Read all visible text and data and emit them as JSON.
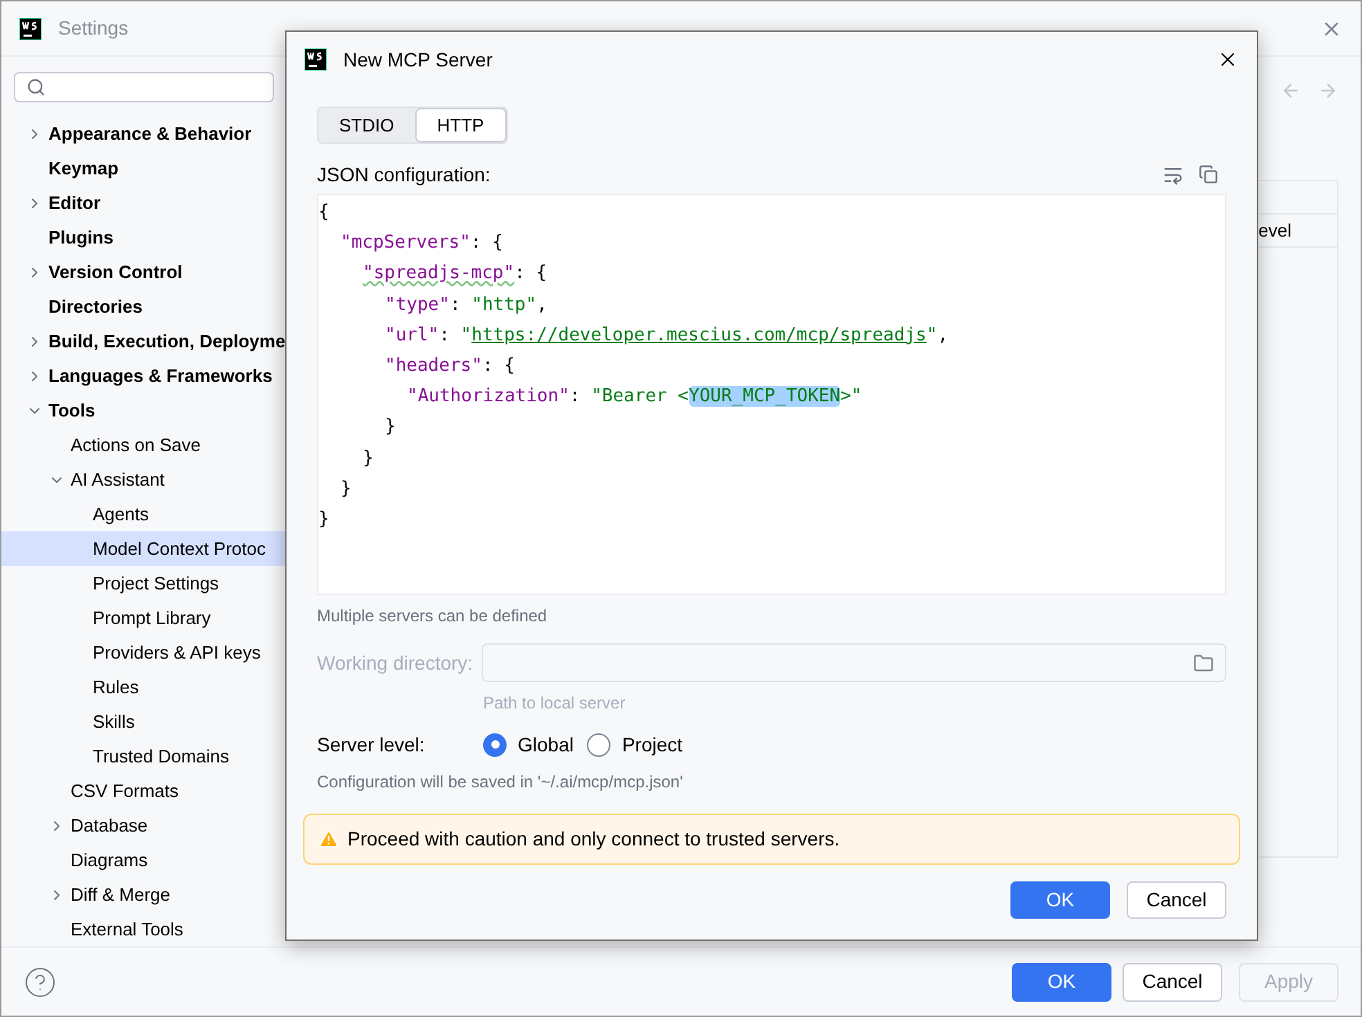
{
  "window": {
    "title": "Settings"
  },
  "sidebar": {
    "items": [
      {
        "label": "Appearance & Behavior",
        "expanded": false
      },
      {
        "label": "Keymap"
      },
      {
        "label": "Editor",
        "expanded": false
      },
      {
        "label": "Plugins"
      },
      {
        "label": "Version Control",
        "expanded": false
      },
      {
        "label": "Directories"
      },
      {
        "label": "Build, Execution, Deployme",
        "expanded": false
      },
      {
        "label": "Languages & Frameworks",
        "expanded": false
      },
      {
        "label": "Tools",
        "expanded": true,
        "children": [
          {
            "label": "Actions on Save"
          },
          {
            "label": "AI Assistant",
            "expanded": true,
            "children": [
              {
                "label": "Agents",
                "selected": false
              },
              {
                "label": "Model Context Protoc",
                "selected": true
              },
              {
                "label": "Project Settings",
                "selected": false
              },
              {
                "label": "Prompt Library",
                "selected": false
              },
              {
                "label": "Providers & API keys",
                "selected": false
              },
              {
                "label": "Rules",
                "selected": false
              },
              {
                "label": "Skills",
                "selected": false
              },
              {
                "label": "Trusted Domains",
                "selected": false
              }
            ]
          },
          {
            "label": "CSV Formats"
          },
          {
            "label": "Database",
            "expanded": false
          },
          {
            "label": "Diagrams"
          },
          {
            "label": "Diff & Merge",
            "expanded": false
          },
          {
            "label": "External Tools"
          }
        ]
      }
    ]
  },
  "content": {
    "table": {
      "column_1": "evel"
    }
  },
  "footer": {
    "buttons": [
      {
        "label": "OK",
        "kind": "primary"
      },
      {
        "label": "Cancel",
        "kind": "normal"
      },
      {
        "label": "Apply",
        "kind": "disabled"
      }
    ]
  },
  "dialog": {
    "title": "New MCP Server",
    "tabs": [
      {
        "label": "STDIO",
        "selected": false
      },
      {
        "label": "HTTP",
        "selected": true
      }
    ],
    "json_label": "JSON configuration:",
    "code": [
      [
        {
          "kind": "punct",
          "text": "{"
        }
      ],
      [
        {
          "kind": "key",
          "text": "\"mcpServers\""
        },
        {
          "kind": "punct",
          "text": ": {"
        }
      ],
      [
        {
          "kind": "key_typo",
          "text": "\"spreadjs-mcp\""
        },
        {
          "kind": "punct",
          "text": ": {"
        }
      ],
      [
        {
          "kind": "key",
          "text": "\"type\""
        },
        {
          "kind": "punct",
          "text": ": "
        },
        {
          "kind": "string",
          "text": "\"http\""
        },
        {
          "kind": "punct",
          "text": ","
        }
      ],
      [
        {
          "kind": "key",
          "text": "\"url\""
        },
        {
          "kind": "punct",
          "text": ": "
        },
        {
          "kind": "string",
          "text": "\""
        },
        {
          "kind": "url",
          "text": "https://developer.mescius.com/mcp/spreadjs"
        },
        {
          "kind": "string",
          "text": "\""
        },
        {
          "kind": "punct",
          "text": ","
        }
      ],
      [
        {
          "kind": "key",
          "text": "\"headers\""
        },
        {
          "kind": "punct",
          "text": ": {"
        }
      ],
      [
        {
          "kind": "key",
          "text": "\"Authorization\""
        },
        {
          "kind": "punct",
          "text": ": "
        },
        {
          "kind": "string",
          "text": "\"Bearer <"
        },
        {
          "kind": "selected",
          "text": "YOUR_MCP_TOKEN"
        },
        {
          "kind": "string",
          "text": ">\""
        }
      ],
      [
        {
          "kind": "punct",
          "text": "}"
        }
      ],
      [
        {
          "kind": "punct",
          "text": "}"
        }
      ],
      [
        {
          "kind": "punct",
          "text": "}"
        }
      ],
      [
        {
          "kind": "punct",
          "text": "}"
        }
      ]
    ],
    "json_hint": "Multiple servers can be defined",
    "working_directory": {
      "label": "Working directory:",
      "disabled": true,
      "hint": "Path to local server"
    },
    "server_level": {
      "label": "Server level:",
      "options": [
        {
          "label": "Global",
          "selected": true
        },
        {
          "label": "Project",
          "selected": false
        }
      ]
    },
    "save_note": "Configuration will be saved in '~/.ai/mcp/mcp.json'",
    "warning": "Proceed with caution and only connect to trusted servers.",
    "buttons": [
      {
        "label": "OK",
        "kind": "primary"
      },
      {
        "label": "Cancel",
        "kind": "normal"
      }
    ]
  }
}
